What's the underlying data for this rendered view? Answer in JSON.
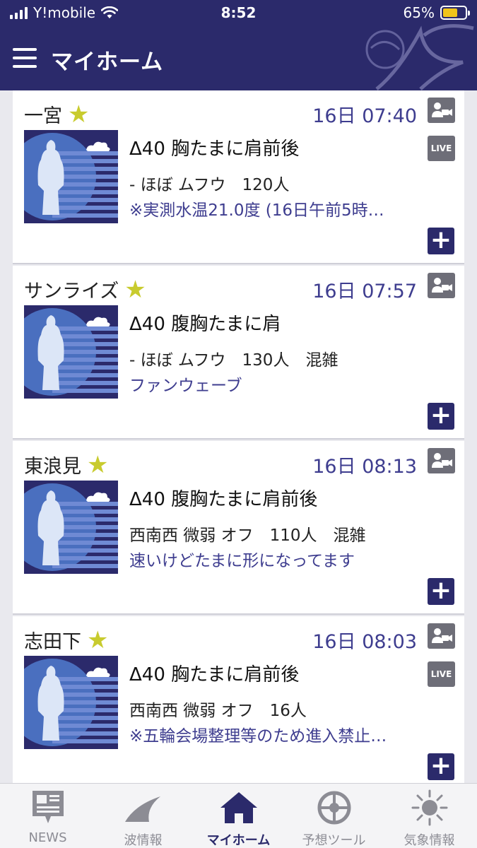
{
  "status_bar": {
    "carrier": "Y!mobile",
    "time": "8:52",
    "battery": "65%",
    "battery_level": 0.65
  },
  "header": {
    "title": "マイホーム"
  },
  "spots": [
    {
      "name": "一宮",
      "datetime": "16日 07:40",
      "live": true,
      "wave_size": "Δ40 胸たまに肩前後",
      "conditions": "- ほぼ ムフウ　120人",
      "comment": "※実測水温21.0度 (16日午前5時…"
    },
    {
      "name": "サンライズ",
      "datetime": "16日 07:57",
      "live": false,
      "wave_size": "Δ40 腹胸たまに肩",
      "conditions": "- ほぼ ムフウ　130人　混雑",
      "comment": "ファンウェーブ"
    },
    {
      "name": "東浪見",
      "datetime": "16日 08:13",
      "live": false,
      "wave_size": "Δ40 腹胸たまに肩前後",
      "conditions": "西南西 微弱 オフ　110人　混雑",
      "comment": "速いけどたまに形になってます"
    },
    {
      "name": "志田下",
      "datetime": "16日 08:03",
      "live": true,
      "wave_size": "Δ40 胸たまに肩前後",
      "conditions": "西南西 微弱 オフ　16人",
      "comment": "※五輪会場整理等のため進入禁止…"
    }
  ],
  "live_label": "LIVE",
  "add_label": "+",
  "star_icon": "★",
  "tabs": [
    {
      "label": "NEWS",
      "icon": "news-icon",
      "active": false
    },
    {
      "label": "波情報",
      "icon": "wave-icon",
      "active": false
    },
    {
      "label": "マイホーム",
      "icon": "home-icon",
      "active": true
    },
    {
      "label": "予想ツール",
      "icon": "forecast-icon",
      "active": false
    },
    {
      "label": "気象情報",
      "icon": "weather-icon",
      "active": false
    }
  ],
  "colors": {
    "brand": "#2b2a6b",
    "accent_text": "#3e3d8f",
    "star": "#c8cb2e"
  }
}
